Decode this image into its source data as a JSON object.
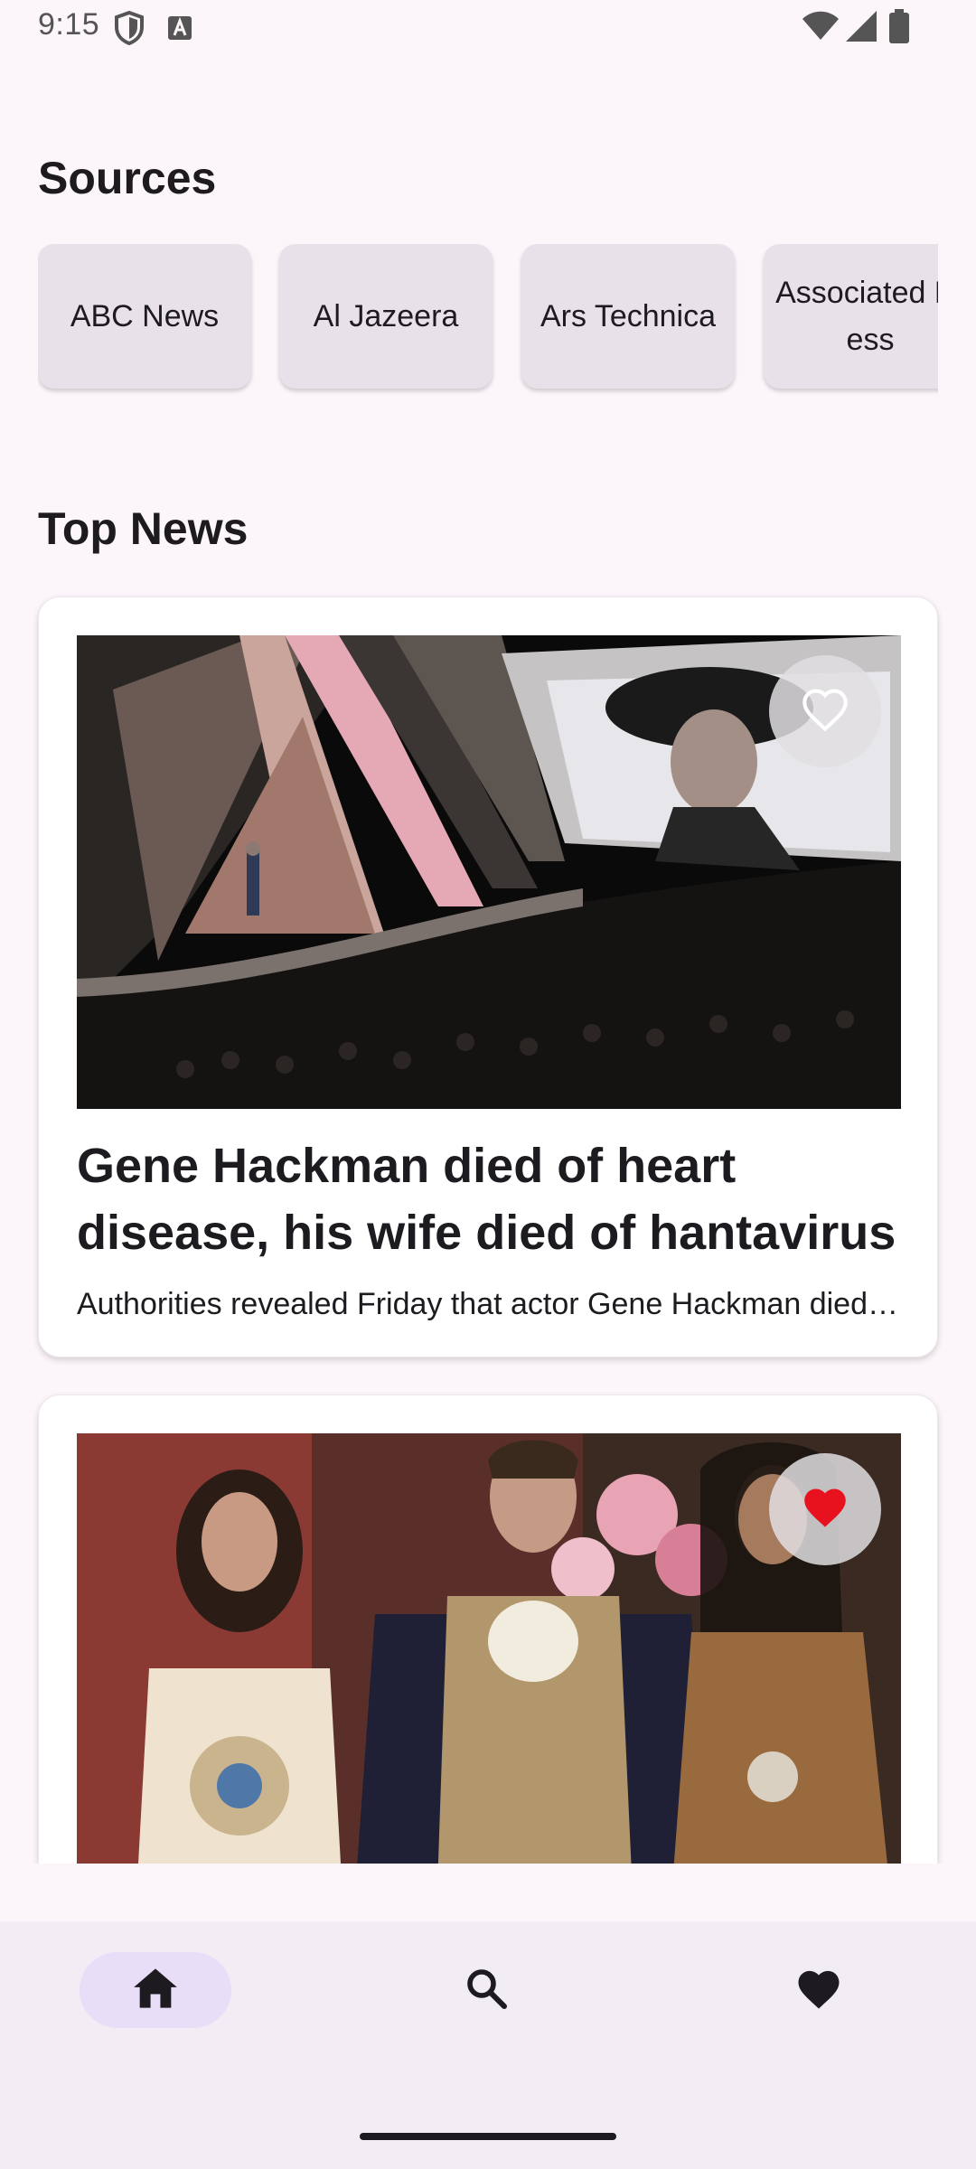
{
  "status_bar": {
    "time": "9:15"
  },
  "sources": {
    "title": "Sources",
    "items": [
      {
        "label": "ABC News"
      },
      {
        "label": "Al Jazeera"
      },
      {
        "label": "Ars Technica"
      },
      {
        "label": "Associated Press"
      }
    ]
  },
  "top_news": {
    "title": "Top News",
    "articles": [
      {
        "title": "Gene Hackman died of heart disease, his wife died of hantavirus",
        "description": "Authorities revealed Friday that actor Gene Hackman died of heart disease",
        "favorited": false,
        "image_icon": "news-photo"
      },
      {
        "title": "",
        "description": "",
        "favorited": true,
        "image_icon": "news-photo"
      }
    ]
  },
  "bottom_nav": {
    "items": [
      {
        "name": "home",
        "icon": "home-icon",
        "selected": true
      },
      {
        "name": "search",
        "icon": "search-icon",
        "selected": false
      },
      {
        "name": "favorites",
        "icon": "heart-icon",
        "selected": false
      }
    ]
  },
  "colors": {
    "background": "#FCF6FB",
    "chip": "#E8E1E9",
    "nav_background": "#F2ECF4",
    "nav_selected": "#E8DEF8",
    "favorite_active": "#E8121F"
  }
}
